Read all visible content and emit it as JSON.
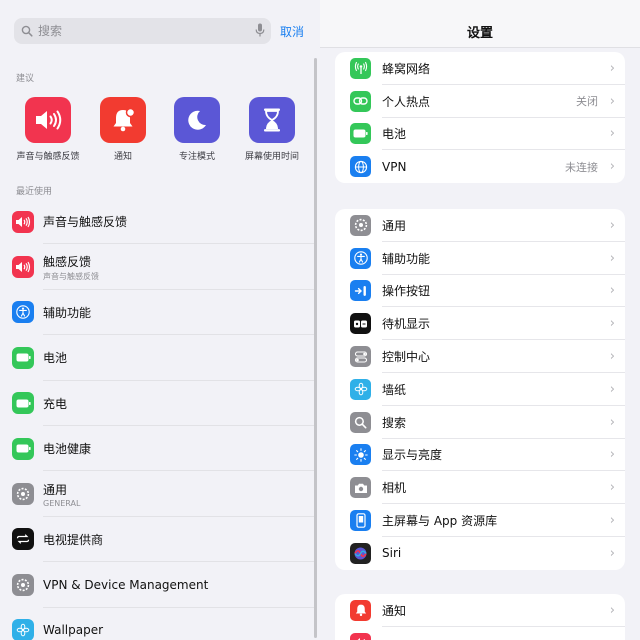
{
  "search": {
    "placeholder": "搜索",
    "cancel_label": "取消"
  },
  "suggestions": {
    "label": "建议",
    "items": [
      {
        "label": "声音与触感反馈",
        "icon": "speaker-icon",
        "color": "#f2344f"
      },
      {
        "label": "通知",
        "icon": "bell-icon",
        "color": "#f23b30"
      },
      {
        "label": "专注模式",
        "icon": "moon-icon",
        "color": "#5b57d6"
      },
      {
        "label": "屏幕使用时间",
        "icon": "hourglass-icon",
        "color": "#5b57d6"
      }
    ]
  },
  "recent": {
    "label": "最近使用",
    "items": [
      {
        "label": "声音与触感反馈",
        "sub": "",
        "icon": "speaker-icon",
        "color": "#f2344f"
      },
      {
        "label": "触感反馈",
        "sub": "声音与触感反馈",
        "icon": "speaker-icon",
        "color": "#f2344f"
      },
      {
        "label": "辅助功能",
        "sub": "",
        "icon": "accessibility-icon",
        "color": "#1a7ff0"
      },
      {
        "label": "电池",
        "sub": "",
        "icon": "battery-icon",
        "color": "#34c759"
      },
      {
        "label": "充电",
        "sub": "",
        "icon": "battery-icon",
        "color": "#34c759"
      },
      {
        "label": "电池健康",
        "sub": "",
        "icon": "battery-icon",
        "color": "#34c759"
      },
      {
        "label": "通用",
        "sub": "GENERAL",
        "icon": "gear-icon",
        "color": "#8e8e93"
      },
      {
        "label": "电视提供商",
        "sub": "",
        "icon": "tv-provider-icon",
        "color": "#111111"
      },
      {
        "label": "VPN & Device Management",
        "sub": "",
        "icon": "gear-icon",
        "color": "#8e8e93"
      },
      {
        "label": "Wallpaper",
        "sub": "",
        "icon": "flower-icon",
        "color": "#2fb0e8"
      }
    ]
  },
  "settings": {
    "title": "设置",
    "groups": [
      {
        "rows": [
          {
            "label": "蜂窝网络",
            "value": "",
            "icon": "antenna-icon",
            "color": "#34c759"
          },
          {
            "label": "个人热点",
            "value": "关闭",
            "icon": "link-icon",
            "color": "#34c759"
          },
          {
            "label": "电池",
            "value": "",
            "icon": "battery-icon",
            "color": "#34c759"
          },
          {
            "label": "VPN",
            "value": "未连接",
            "icon": "globe-icon",
            "color": "#1a7ff0"
          }
        ]
      },
      {
        "rows": [
          {
            "label": "通用",
            "value": "",
            "icon": "gear-icon",
            "color": "#8e8e93"
          },
          {
            "label": "辅助功能",
            "value": "",
            "icon": "accessibility-icon",
            "color": "#1a7ff0"
          },
          {
            "label": "操作按钮",
            "value": "",
            "icon": "action-button-icon",
            "color": "#1a7ff0"
          },
          {
            "label": "待机显示",
            "value": "",
            "icon": "standby-icon",
            "color": "#111111"
          },
          {
            "label": "控制中心",
            "value": "",
            "icon": "toggles-icon",
            "color": "#8e8e93"
          },
          {
            "label": "墙纸",
            "value": "",
            "icon": "flower-icon",
            "color": "#2fb0e8"
          },
          {
            "label": "搜索",
            "value": "",
            "icon": "search-icon",
            "color": "#8e8e93"
          },
          {
            "label": "显示与亮度",
            "value": "",
            "icon": "sun-icon",
            "color": "#1a7ff0"
          },
          {
            "label": "相机",
            "value": "",
            "icon": "camera-icon",
            "color": "#8e8e93"
          },
          {
            "label": "主屏幕与 App 资源库",
            "value": "",
            "icon": "home-screen-icon",
            "color": "#1a7ff0"
          },
          {
            "label": "Siri",
            "value": "",
            "icon": "siri-icon",
            "color": "#222222"
          }
        ]
      },
      {
        "rows": [
          {
            "label": "通知",
            "value": "",
            "icon": "bell-icon",
            "color": "#f23b30"
          },
          {
            "label": "",
            "value": "",
            "icon": "speaker-icon",
            "color": "#f2344f"
          }
        ]
      }
    ]
  }
}
